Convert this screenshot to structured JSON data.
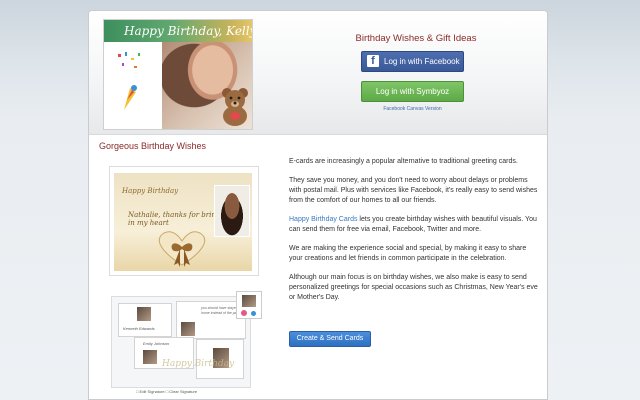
{
  "header": {
    "hero_banner": "Happy Birthday, Kelly!",
    "brand_title": "Birthday Wishes & Gift Ideas",
    "facebook_button": "Log in with Facebook",
    "facebook_glyph": "f",
    "symbyoz_button": "Log in with Symbyoz",
    "canvas_link": "Facebook Canvas Version"
  },
  "section": {
    "title": "Gorgeous Birthday Wishes"
  },
  "screenshot1": {
    "line1": "Happy Birthday",
    "line2": "Nathalie, thanks for bringing joy in my heart"
  },
  "screenshot2": {
    "name1": "Kenneth Edwards",
    "name2": "Emily Johnson",
    "caption": "you should have stayed home instead of the party",
    "watermark": "Happy Birthday",
    "toolbar": "□ Edit Signature   □ Clear Signature"
  },
  "paragraphs": {
    "p1": "E-cards are increasingly a popular alternative to traditional greeting cards.",
    "p2": "They save you money, and you don't need to worry about delays or problems with postal mail. Plus with services like Facebook, it's really easy to send wishes from the comfort of our homes to all our friends.",
    "p3_link": "Happy Birthday Cards",
    "p3_rest": " lets you create birthday wishes with beautiful visuals. You can send them for free via email, Facebook, Twitter and more.",
    "p4": "We are making the experience social and special, by making it easy to share your creations and let friends in common participate in the celebration.",
    "p5": "Although our main focus is on birthday wishes, we also make is easy to send personalized greetings for special occasions such as Christmas, New Year's eve or Mother's Day."
  },
  "cta": {
    "create_button": "Create & Send Cards"
  },
  "colors": {
    "accent_red": "#8b2a2a",
    "facebook_blue": "#3b5998",
    "symbyoz_green": "#5ea948",
    "link_blue": "#3b78c3"
  }
}
